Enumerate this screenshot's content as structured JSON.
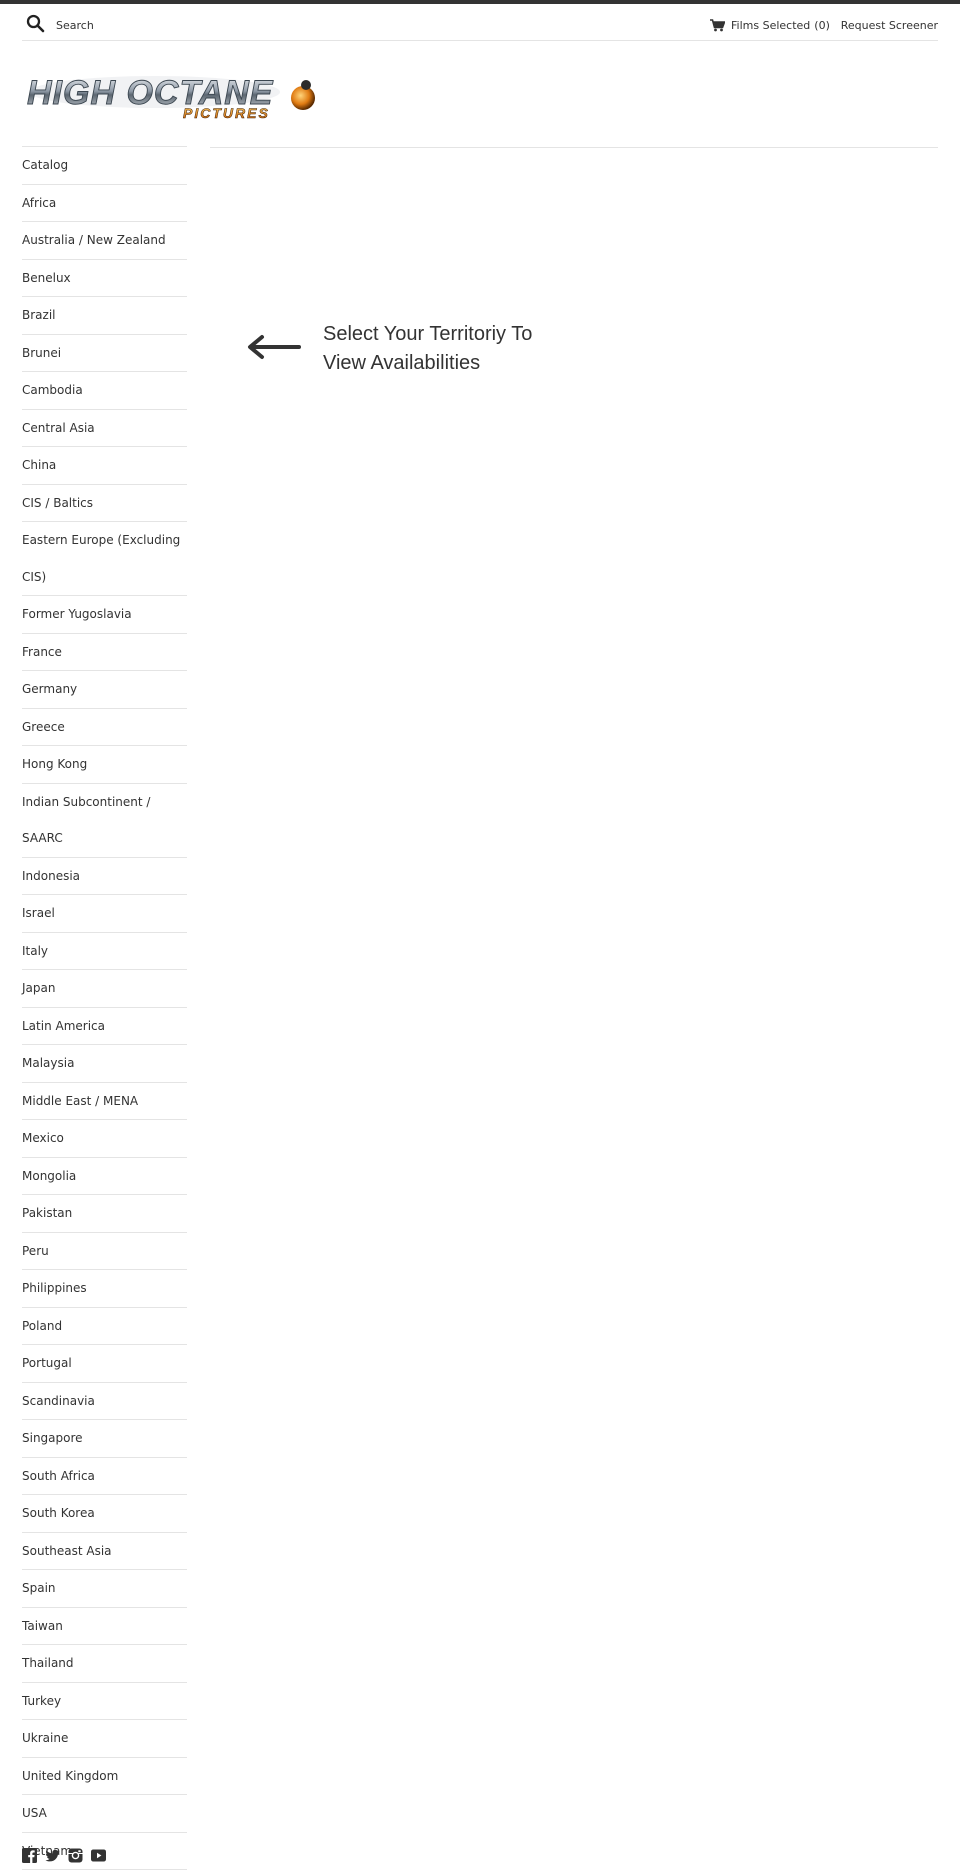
{
  "header": {
    "search_placeholder": "Search",
    "cart_label": "Films Selected",
    "cart_count": "(0)",
    "request_screener": "Request Screener"
  },
  "logo": {
    "line1": "HIGH OCTANE",
    "line2": "PICTURES"
  },
  "sidebar": {
    "items": [
      "Catalog",
      "Africa",
      "Australia / New Zealand",
      "Benelux",
      "Brazil",
      "Brunei",
      "Cambodia",
      "Central Asia",
      "China",
      "CIS / Baltics",
      "Eastern Europe (Excluding CIS)",
      "Former Yugoslavia",
      "France",
      "Germany",
      "Greece",
      "Hong Kong",
      "Indian Subcontinent / SAARC",
      "Indonesia",
      "Israel",
      "Italy",
      "Japan",
      "Latin America",
      "Malaysia",
      "Middle East / MENA",
      "Mexico",
      "Mongolia",
      "Pakistan",
      "Peru",
      "Philippines",
      "Poland",
      "Portugal",
      "Scandinavia",
      "Singapore",
      "South Africa",
      "South Korea",
      "Southeast Asia",
      "Spain",
      "Taiwan",
      "Thailand",
      "Turkey",
      "Ukraine",
      "United Kingdom",
      "USA",
      "Vietnam"
    ]
  },
  "main": {
    "prompt_line1": "Select Your Territoriy To",
    "prompt_line2": "View Availabilities"
  },
  "social": [
    "facebook-icon",
    "twitter-icon",
    "instagram-icon",
    "youtube-icon"
  ],
  "colors": {
    "text": "#333333",
    "border": "#e4e4e4",
    "topbar": "#333333"
  }
}
